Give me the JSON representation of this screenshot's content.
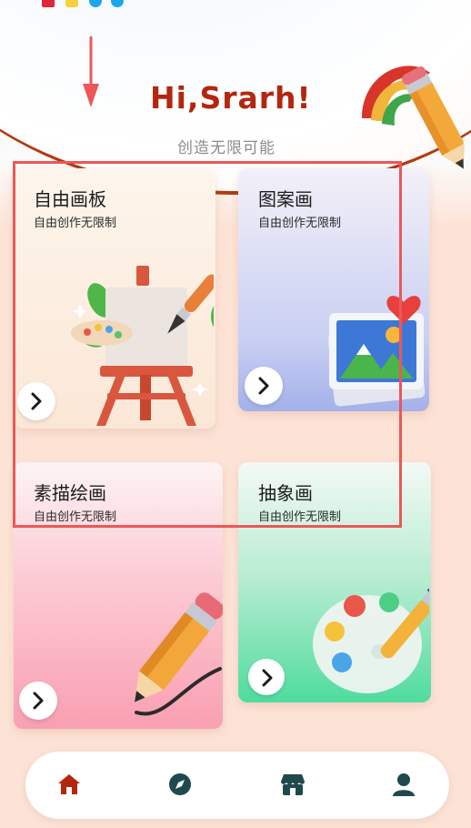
{
  "header": {
    "greeting": "Hi,Srarh!",
    "subtitle": "创造无限可能"
  },
  "cards": [
    {
      "title": "自由画板",
      "description": "自由创作无限制",
      "illustration": "easel-icon"
    },
    {
      "title": "图案画",
      "description": "自由创作无限制",
      "illustration": "picture-frame-icon"
    },
    {
      "title": "素描绘画",
      "description": "自由创作无限制",
      "illustration": "pencil-icon"
    },
    {
      "title": "抽象画",
      "description": "自由创作无限制",
      "illustration": "palette-icon"
    }
  ],
  "bottom_nav": [
    {
      "icon": "home-icon",
      "active": true
    },
    {
      "icon": "compass-icon",
      "active": false
    },
    {
      "icon": "store-icon",
      "active": false
    },
    {
      "icon": "user-icon",
      "active": false
    }
  ],
  "colors": {
    "accent": "#b3260f",
    "nav_inactive": "#1f4a4d",
    "highlight": "#ec5757"
  }
}
